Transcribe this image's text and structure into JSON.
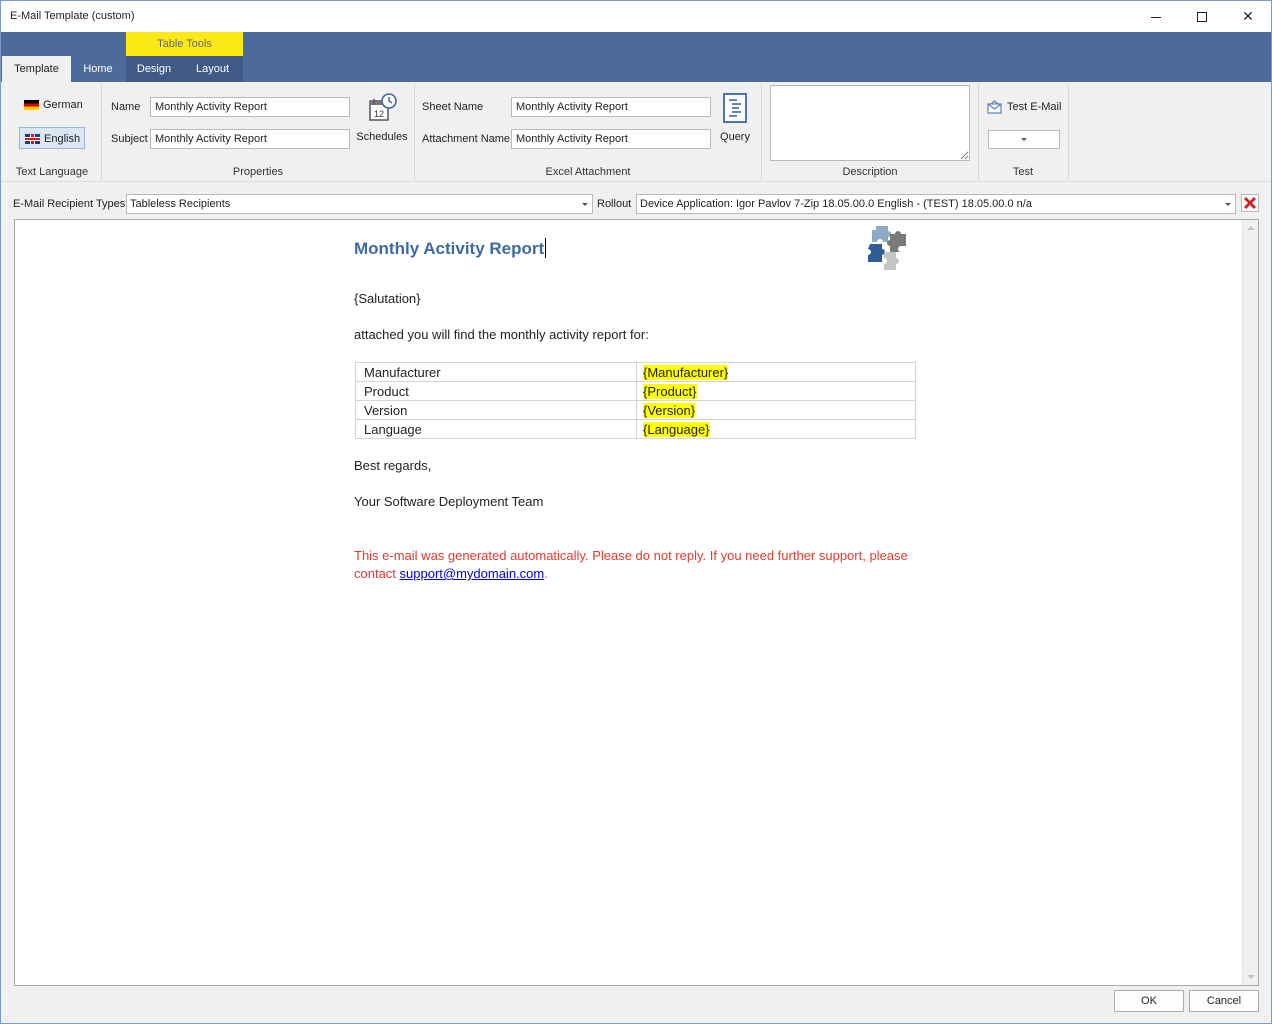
{
  "window": {
    "title": "E-Mail Template (custom)"
  },
  "ribbon": {
    "contextual_label": "Table Tools",
    "tabs": [
      {
        "label": "Template",
        "active": true
      },
      {
        "label": "Home",
        "active": false
      },
      {
        "label": "Design",
        "active": false
      },
      {
        "label": "Layout",
        "active": false
      }
    ],
    "text_language": {
      "group_label": "Text Language",
      "german": "German",
      "english": "English",
      "selected": "English"
    },
    "properties": {
      "group_label": "Properties",
      "name_label": "Name",
      "name_value": "Monthly Activity Report",
      "subject_label": "Subject",
      "subject_value": "Monthly Activity Report",
      "schedules_label": "Schedules"
    },
    "excel_attachment": {
      "group_label": "Excel Attachment",
      "sheet_name_label": "Sheet Name",
      "sheet_name_value": "Monthly Activity Report",
      "attachment_name_label": "Attachment Name",
      "attachment_name_value": "Monthly Activity Report",
      "query_label": "Query"
    },
    "description": {
      "group_label": "Description"
    },
    "test": {
      "group_label": "Test",
      "test_email_label": "Test E-Mail"
    }
  },
  "recipient_bar": {
    "types_label": "E-Mail Recipient Types",
    "types_value": "Tableless Recipients",
    "rollout_label": "Rollout",
    "rollout_value": "Device Application: Igor Pavlov 7-Zip 18.05.00.0 English - (TEST) 18.05.00.0 n/a"
  },
  "document": {
    "title": "Monthly Activity Report",
    "salutation": "{Salutation}",
    "intro": "attached you will find the monthly activity report for:",
    "table": [
      {
        "key": "Manufacturer",
        "value": "{Manufacturer}"
      },
      {
        "key": "Product",
        "value": "{Product}"
      },
      {
        "key": "Version",
        "value": "{Version}"
      },
      {
        "key": "Language",
        "value": "{Language}"
      }
    ],
    "closing": "Best regards,",
    "signature": "Your Software Deployment Team",
    "notice_text": "This e-mail was generated automatically. Please do not reply. If you need further support, please contact ",
    "notice_link": "support@mydomain.com",
    "notice_end": "."
  },
  "footer": {
    "ok_label": "OK",
    "cancel_label": "Cancel"
  },
  "colors": {
    "ribbon_header": "#4c6b9b",
    "contextual_tab": "#fce815",
    "doc_title": "#3d6aa3",
    "notice": "#e33a2f",
    "highlight": "#ffff00"
  }
}
